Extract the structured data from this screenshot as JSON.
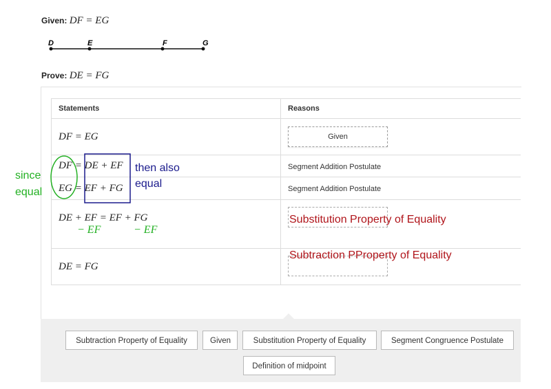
{
  "given": {
    "label": "Given:",
    "expr": "DF = EG"
  },
  "prove": {
    "label": "Prove:",
    "expr": "DE = FG"
  },
  "segment": {
    "points": [
      "D",
      "E",
      "F",
      "G"
    ]
  },
  "table": {
    "headers": {
      "statements": "Statements",
      "reasons": "Reasons"
    },
    "rows": [
      {
        "statement": "DF = EG",
        "reason": "Given"
      },
      {
        "statement": "DF = DE + EF",
        "reason": "Segment Addition Postulate"
      },
      {
        "statement": "EG = EF + FG",
        "reason": "Segment Addition Postulate"
      },
      {
        "statement": "DE + EF = EF + FG",
        "reason": ""
      },
      {
        "statement": "DE = FG",
        "reason": ""
      }
    ]
  },
  "annotations": {
    "since": "since",
    "equal_left": "equal",
    "then_also": "then also",
    "equal_right": "equal",
    "minus_ef_1": "− EF",
    "minus_ef_2": "− EF",
    "handwritten_reason_4": "Substitution  Property  of  Equality",
    "handwritten_reason_5": "Subtraction  PProperty  of  Equality",
    "colors": {
      "green": "#22b022",
      "blue": "#1a1a8c",
      "red": "#b0141a"
    }
  },
  "bank": {
    "chips": [
      "Subtraction Property of Equality",
      "Given",
      "Substitution Property of Equality",
      "Segment Congruence Postulate",
      "Definition of midpoint"
    ]
  }
}
